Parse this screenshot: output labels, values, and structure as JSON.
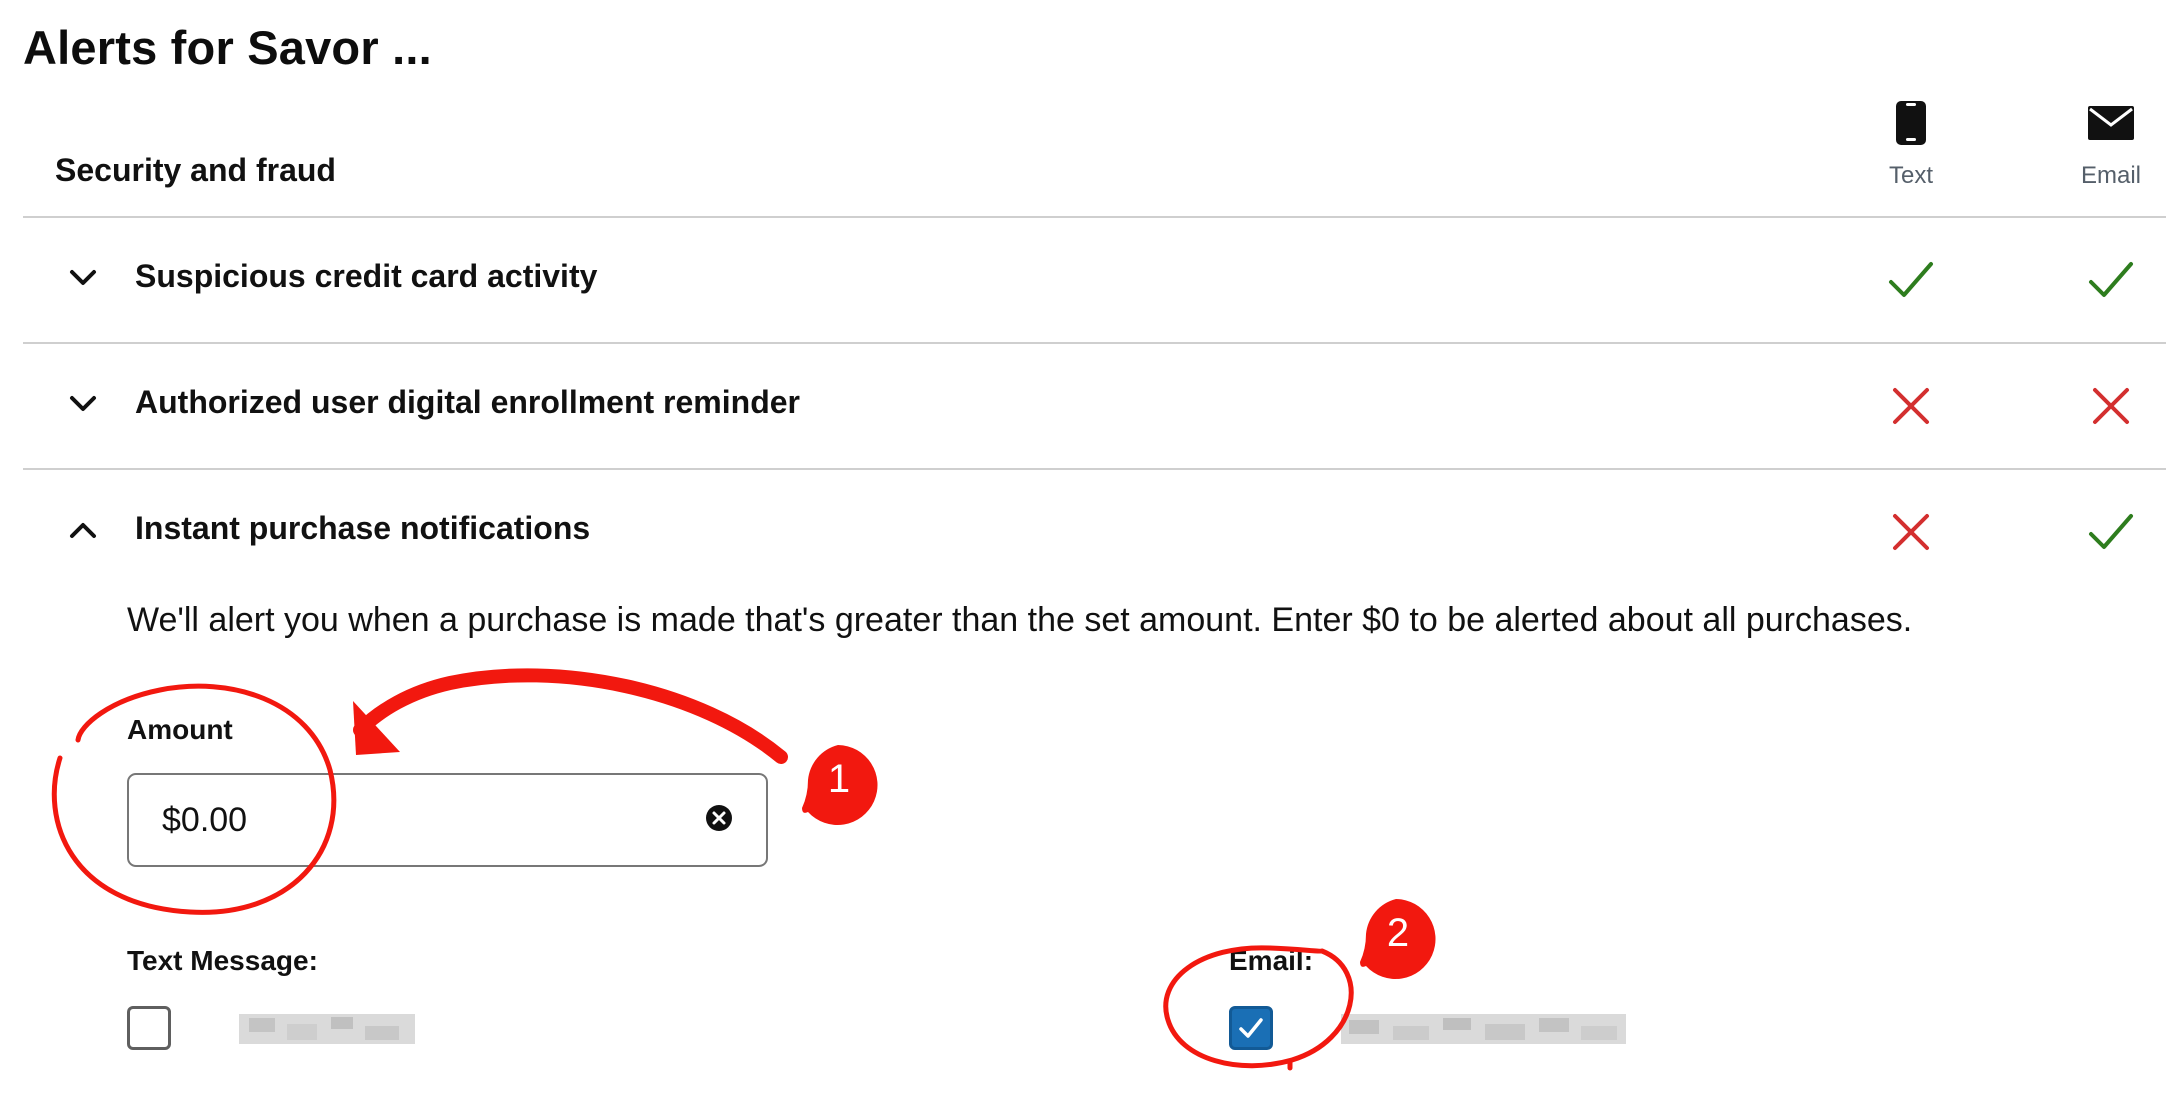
{
  "page": {
    "title": "Alerts for Savor ..."
  },
  "section": {
    "title": "Security and fraud"
  },
  "columns": {
    "text_label": "Text",
    "email_label": "Email"
  },
  "rows": [
    {
      "label": "Suspicious credit card activity",
      "text": true,
      "email": true,
      "expanded": false
    },
    {
      "label": "Authorized user digital enrollment reminder",
      "text": false,
      "email": false,
      "expanded": false
    },
    {
      "label": "Instant purchase notifications",
      "text": false,
      "email": true,
      "expanded": true
    }
  ],
  "instant_purchase": {
    "description": "We'll alert you when a purchase is made that's greater than the set amount. Enter $0 to be alerted about all purchases.",
    "amount_label": "Amount",
    "amount_value": "$0.00",
    "text_message_label": "Text Message:",
    "text_message_checked": false,
    "email_label": "Email:",
    "email_checked": true
  },
  "annotations": {
    "badge_1": "1",
    "badge_2": "2"
  },
  "colors": {
    "check": "#2e7d1e",
    "cross": "#d32f2f",
    "annotation": "#f2180f",
    "checkbox_on": "#1a6fb5"
  }
}
